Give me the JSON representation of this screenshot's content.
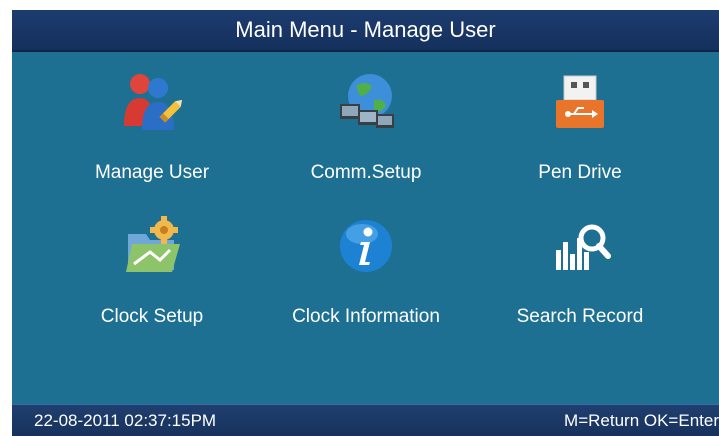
{
  "title": "Main Menu - Manage User",
  "menu": [
    {
      "label": "Manage User",
      "icon": "users-pencil-icon"
    },
    {
      "label": "Comm.Setup",
      "icon": "network-globe-icon"
    },
    {
      "label": "Pen Drive",
      "icon": "usb-drive-icon"
    },
    {
      "label": "Clock Setup",
      "icon": "folder-gear-icon"
    },
    {
      "label": "Clock Information",
      "icon": "info-icon"
    },
    {
      "label": "Search Record",
      "icon": "search-chart-icon"
    }
  ],
  "status": {
    "datetime": "22-08-2011  02:37:15PM",
    "hints": "M=Return OK=Enter"
  },
  "colors": {
    "background": "#1d7092",
    "titlebar": "#183565",
    "statusbar": "#17315b"
  }
}
